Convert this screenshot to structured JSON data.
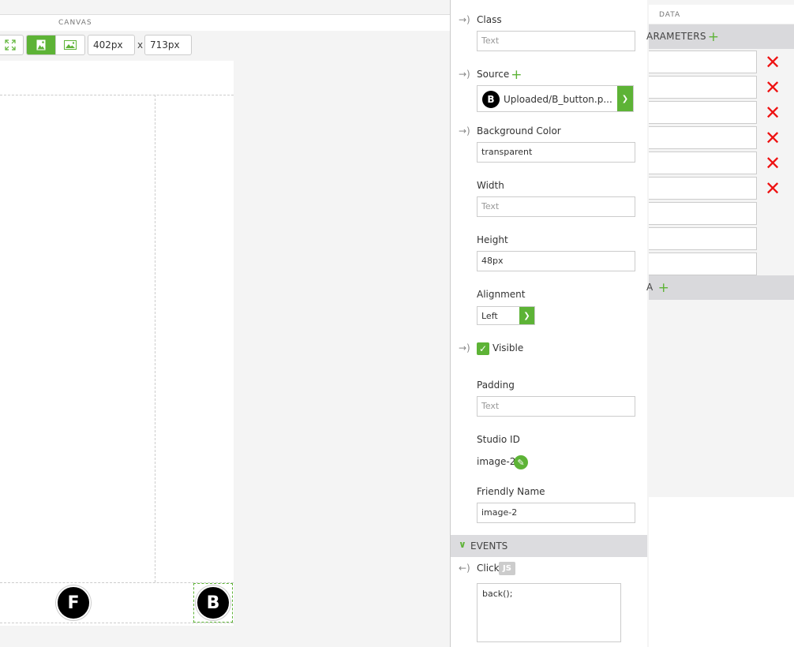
{
  "canvas": {
    "title": "CANVAS",
    "width_value": "402px",
    "separator": "x",
    "height_value": "713px",
    "buttons": {
      "f_label": "F",
      "b_label": "B"
    }
  },
  "properties": {
    "class_label": "Class",
    "class_placeholder": "Text",
    "source_label": "Source",
    "source_value": "Uploaded/B_button.p...",
    "source_icon_letter": "B",
    "bg_color_label": "Background Color",
    "bg_color_value": "transparent",
    "width_label": "Width",
    "width_placeholder": "Text",
    "height_label": "Height",
    "height_value": "48px",
    "alignment_label": "Alignment",
    "alignment_value": "Left",
    "visible_label": "Visible",
    "padding_label": "Padding",
    "padding_placeholder": "Text",
    "studio_id_label": "Studio ID",
    "studio_id_value": "image-2",
    "friendly_name_label": "Friendly Name",
    "friendly_name_value": "image-2",
    "events_label": "EVENTS",
    "click_label": "Click",
    "js_badge": "JS",
    "click_code": "back();"
  },
  "data_panel": {
    "title": "DATA",
    "parameters_label": "ARAMETERS",
    "second_section_label": "A"
  },
  "colors": {
    "accent": "#5db336",
    "delete": "#e11111"
  },
  "icons": {
    "bind_arrow": "bind-arrow-icon",
    "event_arrow": "event-arrow-icon",
    "fit": "fit-screen-icon",
    "portrait": "portrait-image-icon",
    "landscape": "landscape-image-icon",
    "plus": "plus-icon",
    "delete": "close-x-icon",
    "edit": "pencil-icon",
    "check": "check-icon",
    "chevron": "chevron-down-icon"
  }
}
